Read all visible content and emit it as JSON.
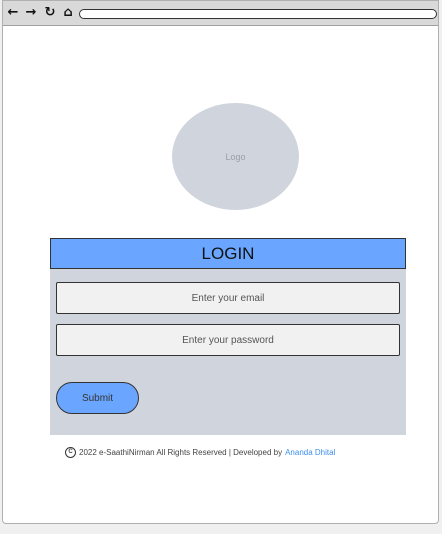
{
  "browser": {
    "toolbar": {
      "back_icon": "back-arrow-icon",
      "forward_icon": "forward-arrow-icon",
      "reload_icon": "reload-icon",
      "home_icon": "home-icon",
      "address": ""
    }
  },
  "logo": {
    "label": "Logo"
  },
  "login": {
    "title": "LOGIN",
    "email_placeholder": "Enter your email",
    "password_placeholder": "Enter your password",
    "submit_label": "Submit"
  },
  "footer": {
    "copyright_symbol": "C",
    "text": "2022 e-SaathiNirman All Rights Reserved | Developed by",
    "developer": "Ananda Dhital"
  },
  "colors": {
    "accent": "#6aa6ff",
    "panel": "#d0d5dd",
    "link": "#3d8ef0"
  }
}
